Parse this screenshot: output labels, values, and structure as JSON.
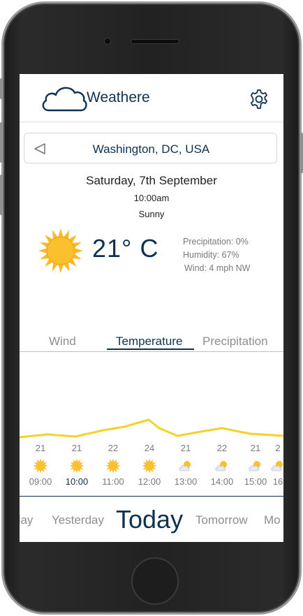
{
  "app": {
    "title": "Weathere",
    "logo_icon": "cloud-icon",
    "settings_icon": "gear-icon"
  },
  "location": {
    "name": "Washington, DC, USA",
    "back_icon": "triangle-left-icon"
  },
  "current": {
    "date": "Saturday, 7th September",
    "time": "10:00am",
    "condition": "Sunny",
    "temperature": "21° C",
    "icon": "sun-icon",
    "precipitation": "Precipitation: 0%",
    "humidity": "Humidity: 67%",
    "wind": "Wind: 4 mph NW"
  },
  "tabs": {
    "wind": "Wind",
    "temperature": "Temperature",
    "precipitation": "Precipitation",
    "active": "Temperature"
  },
  "hourly": [
    {
      "time": "09:00",
      "temp": "21",
      "icon": "sun-icon"
    },
    {
      "time": "10:00",
      "temp": "21",
      "icon": "sun-icon",
      "selected": true
    },
    {
      "time": "11:00",
      "temp": "22",
      "icon": "sun-icon"
    },
    {
      "time": "12:00",
      "temp": "24",
      "icon": "sun-icon"
    },
    {
      "time": "13:00",
      "temp": "21",
      "icon": "partly-cloudy-icon"
    },
    {
      "time": "14:00",
      "temp": "22",
      "icon": "partly-cloudy-icon"
    },
    {
      "time": "15:00",
      "temp": "21",
      "icon": "partly-cloudy-icon"
    },
    {
      "time": "16",
      "temp": "2",
      "icon": "partly-cloudy-icon"
    }
  ],
  "days": {
    "prev2": "day",
    "prev": "Yesterday",
    "today": "Today",
    "next": "Tomorrow",
    "next2": "Mo"
  },
  "colors": {
    "primary": "#0f3150",
    "sun": "#fbb829",
    "graph_line": "#f5d22b",
    "muted": "#8e8e8e"
  }
}
